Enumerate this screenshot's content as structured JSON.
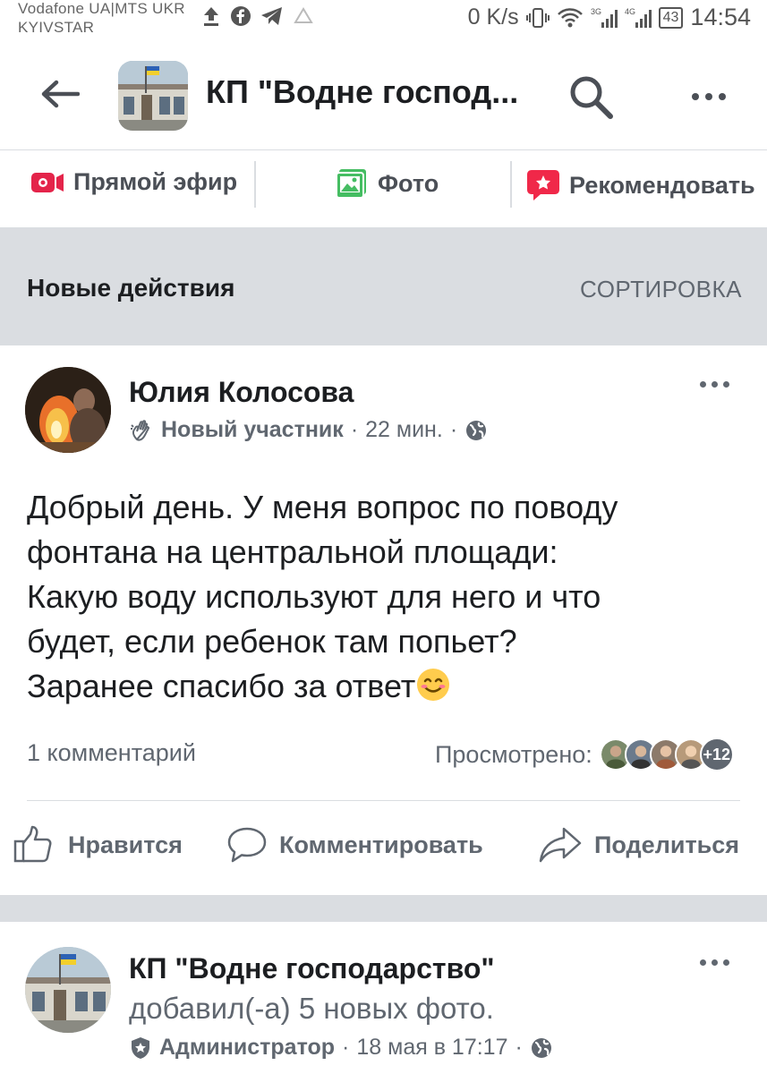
{
  "status_bar": {
    "carrier_1": "Vodafone UA|MTS UKR",
    "carrier_2": "KYIVSTAR",
    "net_speed": "0 K/s",
    "battery": "43",
    "time": "14:54"
  },
  "header": {
    "page_title": "КП \"Водне господ...",
    "icons": [
      "back-arrow-icon",
      "search-icon",
      "more-icon"
    ]
  },
  "actions": {
    "live_label": "Прямой эфир",
    "photo_label": "Фото",
    "recommend_label": "Рекомендовать"
  },
  "feed_header": {
    "title": "Новые действия",
    "sort_label": "СОРТИРОВКА"
  },
  "post1": {
    "author": "Юлия Колосова",
    "role": "Новый участник",
    "time": "22 мин.",
    "text_lines": [
      "Добрый день. У меня вопрос по поводу",
      "фонтана на центральной площади:",
      "Какую воду используют для него  и что",
      "будет, если ребенок там попьет?",
      "Заранее спасибо за ответ"
    ],
    "comments": "1 комментарий",
    "seen_label": "Просмотрено:",
    "seen_more": "+12",
    "like_label": "Нравится",
    "comment_label": "Комментировать",
    "share_label": "Поделиться"
  },
  "post2": {
    "author": "КП \"Водне господарство\"",
    "added": "добавил(-а) 5 новых фото.",
    "role": "Администратор",
    "time": "18 мая в 17:17"
  },
  "colors": {
    "live_red": "#e4244a",
    "photo_green": "#45bd62",
    "recommend_red": "#f02849",
    "divider_gray": "#dadde1"
  }
}
